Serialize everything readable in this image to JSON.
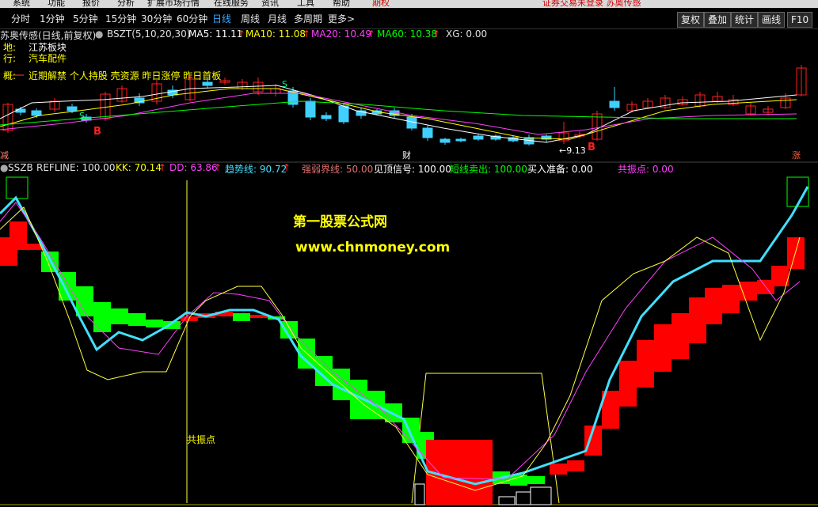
{
  "menu": {
    "items": [
      "系统",
      "功能",
      "报价",
      "分析",
      "扩展市场行情",
      "在线服务",
      "资讯",
      "工具",
      "帮助"
    ],
    "flag": "期权",
    "notice": "证券交易未登录  苏奥传感"
  },
  "periods": [
    "分时",
    "1分钟",
    "5分钟",
    "15分钟",
    "30分钟",
    "60分钟",
    "日线",
    "周线",
    "月线",
    "多周期",
    "更多>"
  ],
  "active_period": "日线",
  "toolbar": [
    "复权",
    "叠加",
    "统计",
    "画线",
    "F10"
  ],
  "main_info": {
    "title": "苏奥传感(日线,前复权)",
    "indicator": "BSZT(5,10,20,30)",
    "ma5": "MA5: 11.11",
    "ma10": "MA10: 11.08",
    "ma20": "MA20: 10.49",
    "ma60": "MA60: 10.38",
    "xg": "XG: 0.00"
  },
  "stock_tags": {
    "row1_prefix": "地:",
    "row1": "江苏板块",
    "row2_prefix": "行:",
    "row2": "汽车配件",
    "row3_prefix": "概:",
    "row3": "近期解禁 个人持股 壳资源 昨日涨停 昨日首板"
  },
  "overlay_labels": {
    "low_price": "←9.13",
    "b_marker": "B",
    "s_marker": "S",
    "bottom_left": "减",
    "bottom_mid": "财",
    "bottom_right": "涨"
  },
  "sub_info": {
    "name": "SSZB",
    "refline": "REFLINE: 100.00",
    "kk": "KK: 70.14",
    "dd": "DD: 63.86",
    "trend": "趋势线: 90.72",
    "weak": "强弱界线: 50.00",
    "top_signal": "见顶信号: 100.00",
    "short_sell": "短线卖出: 100.00",
    "buy_ready": "买入准备: 0.00",
    "resonance": "共振点: 0.00"
  },
  "watermark": {
    "title": "第一股票公式网",
    "url": "www.chnmoney.com"
  },
  "resonance_label": "共振点",
  "colors": {
    "up": "#ff2020",
    "down": "#40d0ff",
    "ma5": "#ffffff",
    "ma10": "#ffff00",
    "ma20": "#ff40ff",
    "ma60": "#00ff00",
    "red_block": "#ff0000",
    "green_block": "#00ff00",
    "trend_line": "#40e0ff",
    "yellow_line": "#ffff40"
  }
}
